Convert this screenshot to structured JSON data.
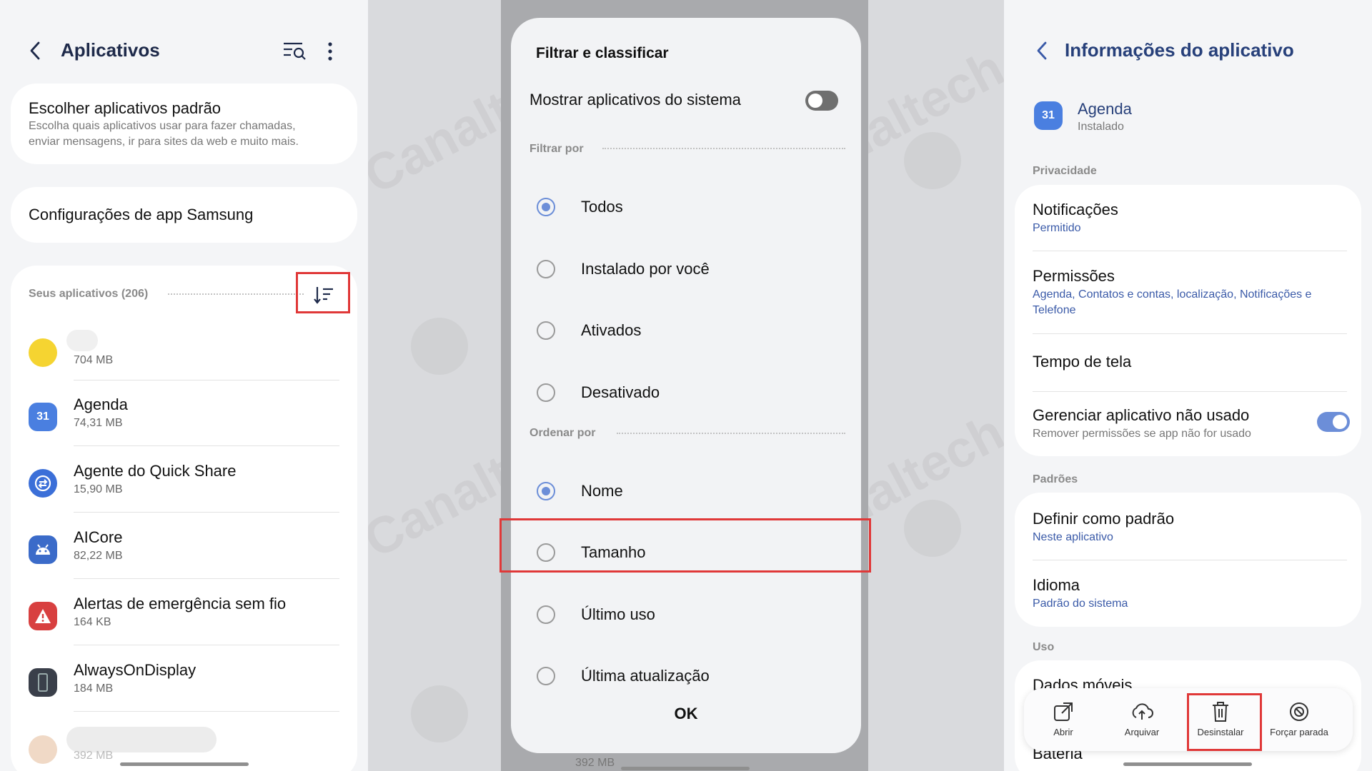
{
  "left": {
    "header": {
      "title": "Aplicativos",
      "back_icon": "back-arrow-icon",
      "search_icon": "search-list-icon",
      "more_icon": "more-vertical-icon"
    },
    "default_apps": {
      "title": "Escolher aplicativos padrão",
      "description_line1": "Escolha quais aplicativos usar para fazer chamadas,",
      "description_line2": "enviar mensagens, ir para sites da web e muito mais."
    },
    "samsung_settings": {
      "title": "Configurações de app Samsung"
    },
    "apps_section": {
      "label": "Seus aplicativos (206)",
      "sort_icon": "sort-icon"
    },
    "apps": [
      {
        "name": "",
        "size": "704 MB",
        "color": "#f5d431"
      },
      {
        "name": "Agenda",
        "size": "74,31 MB",
        "color": "#4a7fe0",
        "icon_text": "31"
      },
      {
        "name": "Agente do Quick Share",
        "size": "15,90 MB",
        "color": "#3b6fd8"
      },
      {
        "name": "AICore",
        "size": "82,22 MB",
        "color": "#3b6bc9"
      },
      {
        "name": "Alertas de emergência sem fio",
        "size": "164 KB",
        "color": "#d84040"
      },
      {
        "name": "AlwaysOnDisplay",
        "size": "184 MB",
        "color": "#3a3f4a"
      },
      {
        "name": "",
        "size": "392 MB",
        "color": "#f0d9c6"
      }
    ]
  },
  "dialog": {
    "title": "Filtrar e classificar",
    "show_system": {
      "label": "Mostrar aplicativos do sistema",
      "on": false
    },
    "filter_section": "Filtrar por",
    "filter_options": [
      "Todos",
      "Instalado por você",
      "Ativados",
      "Desativado"
    ],
    "filter_selected": "Todos",
    "order_section": "Ordenar por",
    "order_options": [
      "Nome",
      "Tamanho",
      "Último uso",
      "Última atualização"
    ],
    "order_selected": "Nome",
    "ok_label": "OK",
    "behind_size": "392 MB"
  },
  "right": {
    "header": {
      "title": "Informações do aplicativo",
      "back_icon": "back-arrow-icon"
    },
    "app": {
      "name": "Agenda",
      "status": "Instalado",
      "icon_text": "31"
    },
    "privacy_section": "Privacidade",
    "notifications": {
      "title": "Notificações",
      "value": "Permitido"
    },
    "permissions": {
      "title": "Permissões",
      "value_line1": "Agenda, Contatos e contas, localização, Notificações e",
      "value_line2": "Telefone"
    },
    "screen_time": {
      "title": "Tempo de tela"
    },
    "manage_unused": {
      "title": "Gerenciar aplicativo não usado",
      "value": "Remover permissões se app não for usado",
      "on": true
    },
    "defaults_section": "Padrões",
    "set_default": {
      "title": "Definir como padrão",
      "value": "Neste aplicativo"
    },
    "language": {
      "title": "Idioma",
      "value": "Padrão do sistema"
    },
    "usage_section": "Uso",
    "mobile_data": {
      "title": "Dados móveis"
    },
    "battery": {
      "title": "Bateria"
    },
    "actions": [
      {
        "label": "Abrir",
        "icon": "open-external-icon"
      },
      {
        "label": "Arquivar",
        "icon": "cloud-upload-icon"
      },
      {
        "label": "Desinstalar",
        "icon": "trash-icon"
      },
      {
        "label": "Forçar parada",
        "icon": "block-icon"
      }
    ]
  },
  "watermark": {
    "text": "Canaltech"
  },
  "colors": {
    "accent": "#6c8ed8",
    "highlight": "#e03838",
    "header_text": "#1e2a4a",
    "link_blue": "#3a5aa8"
  }
}
